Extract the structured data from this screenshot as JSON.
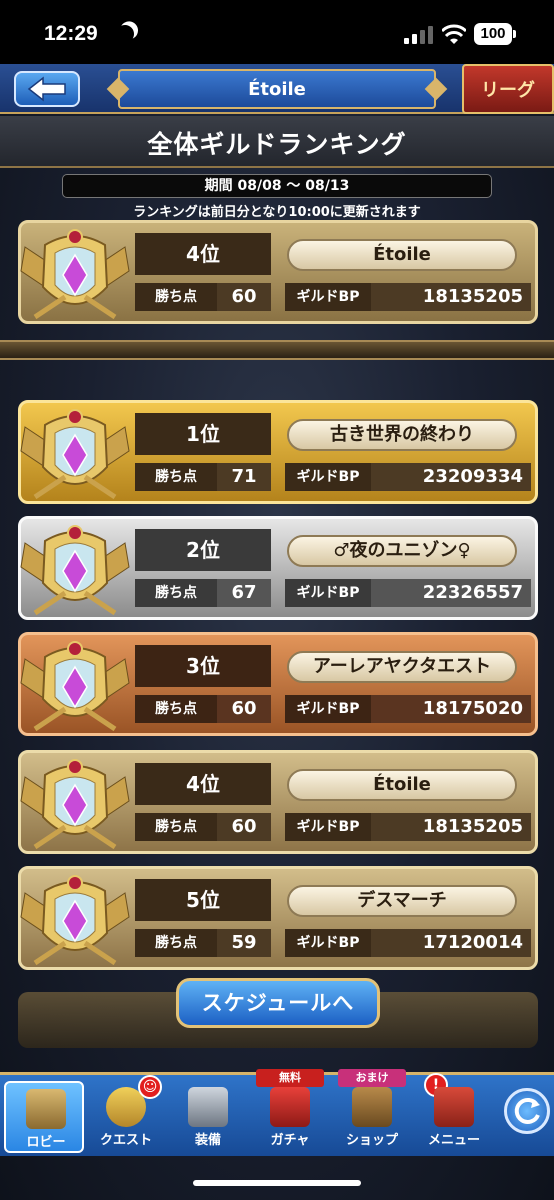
{
  "status_bar": {
    "time": "12:29",
    "battery": "100"
  },
  "header": {
    "back_icon": "back-arrow-icon",
    "guild_name": "Étoile",
    "league_label": "リーグ"
  },
  "ranking": {
    "title": "全体ギルドランキング",
    "period": "期間 08/08 〜 08/13",
    "note": "ランキングは前日分となり10:00に更新されます",
    "labels": {
      "points": "勝ち点",
      "bp": "ギルドBP"
    }
  },
  "my_guild": {
    "rank": "4位",
    "name": "Étoile",
    "points": "60",
    "bp": "18135205"
  },
  "rows": [
    {
      "rank": "1位",
      "name": "古き世界の終わり",
      "points": "71",
      "bp": "23209334"
    },
    {
      "rank": "2位",
      "name": "♂夜のユニゾン♀",
      "points": "67",
      "bp": "22326557"
    },
    {
      "rank": "3位",
      "name": "アーレアヤクタエスト",
      "points": "60",
      "bp": "18175020"
    },
    {
      "rank": "4位",
      "name": "Étoile",
      "points": "60",
      "bp": "18135205"
    },
    {
      "rank": "5位",
      "name": "デスマーチ",
      "points": "59",
      "bp": "17120014"
    }
  ],
  "schedule_button": "スケジュールへ",
  "tabs": [
    {
      "label": "ロビー",
      "icon": "lobby-icon"
    },
    {
      "label": "クエスト",
      "icon": "quest-icon"
    },
    {
      "label": "装備",
      "icon": "equipment-icon"
    },
    {
      "label": "ガチャ",
      "icon": "gacha-icon",
      "ribbon": "無料"
    },
    {
      "label": "ショップ",
      "icon": "shop-icon",
      "ribbon": "おまけ"
    },
    {
      "label": "メニュー",
      "icon": "menu-icon",
      "badge": "!"
    }
  ],
  "colors": {
    "header_blue": "#2a4f93",
    "gold_border": "#d6b46a",
    "tab_blue": "#2f74c9"
  }
}
